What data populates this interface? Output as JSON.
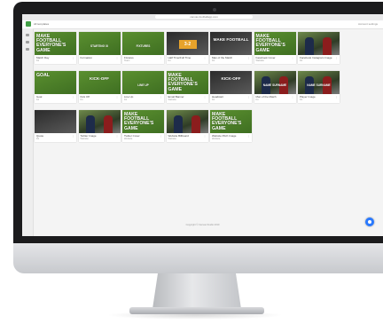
{
  "browser": {
    "url": "canvas.footballapp.com",
    "title_icon": "app-logo-icon"
  },
  "app": {
    "title": "All templates",
    "user": "Account settings"
  },
  "footer": "Copyright © Canvas Studio 2019",
  "fab_icon": "chat-icon",
  "cards": [
    {
      "thumb_text": "MAKE FOOTBALL EVERYONE'S GAME",
      "title": "Match Day",
      "sub": "Kit",
      "style": "green",
      "size": "big"
    },
    {
      "thumb_text": "STARTING XI",
      "title": "Formation",
      "sub": "",
      "style": "green",
      "size": "small"
    },
    {
      "thumb_text": "FIXTURES",
      "title": "Fixtures",
      "sub": "Team",
      "style": "green",
      "size": "small"
    },
    {
      "thumb_text": "3-2",
      "title": "Half Time/Full Time",
      "sub": "Kit",
      "style": "dark",
      "size": "mid"
    },
    {
      "thumb_text": "MAKE FOOTBALL",
      "title": "Man of the Match",
      "sub": "Kit",
      "style": "dark",
      "size": "mid"
    },
    {
      "thumb_text": "MAKE FOOTBALL EVERYONE'S GAME",
      "title": "Facebook Cover",
      "sub": "Website",
      "style": "green",
      "size": "big"
    },
    {
      "thumb_text": "",
      "title": "Facebook Instagram Image",
      "sub": "Kit",
      "style": "photo",
      "size": "big"
    },
    {
      "thumb_text": "GOAL",
      "title": "Goal",
      "sub": "Kit",
      "style": "green",
      "size": "big"
    },
    {
      "thumb_text": "KICK-OFF",
      "title": "Kick Off",
      "sub": "Kit",
      "style": "green",
      "size": "mid"
    },
    {
      "thumb_text": "LINE UP",
      "title": "Line Up",
      "sub": "Kit",
      "style": "green",
      "size": "small"
    },
    {
      "thumb_text": "MAKE FOOTBALL EVERYONE'S GAME",
      "title": "Email Banner",
      "sub": "Website",
      "style": "green",
      "size": "big"
    },
    {
      "thumb_text": "KICK-OFF",
      "title": "Headstart",
      "sub": "Kit",
      "style": "dark",
      "size": "mid"
    },
    {
      "thumb_text": "NAME SURNAME",
      "title": "Man of the Match",
      "sub": "Kit",
      "style": "photo",
      "size": "small"
    },
    {
      "thumb_text": "NAME SURNAME",
      "title": "Player Image",
      "sub": "Kit",
      "style": "photo",
      "size": "small"
    },
    {
      "thumb_text": "",
      "title": "Quote",
      "sub": "Kit",
      "style": "dark",
      "size": "small"
    },
    {
      "thumb_text": "",
      "title": "Twitter Image",
      "sub": "Website",
      "style": "photo",
      "size": "small"
    },
    {
      "thumb_text": "MAKE FOOTBALL EVERYONE'S GAME",
      "title": "Twitter Cover",
      "sub": "Website",
      "style": "green",
      "size": "big"
    },
    {
      "thumb_text": "",
      "title": "Website Billboard",
      "sub": "Website",
      "style": "photo",
      "size": "small"
    },
    {
      "thumb_text": "MAKE FOOTBALL EVERYONE'S GAME",
      "title": "Website Pitch Image",
      "sub": "Website",
      "style": "green",
      "size": "big"
    }
  ]
}
